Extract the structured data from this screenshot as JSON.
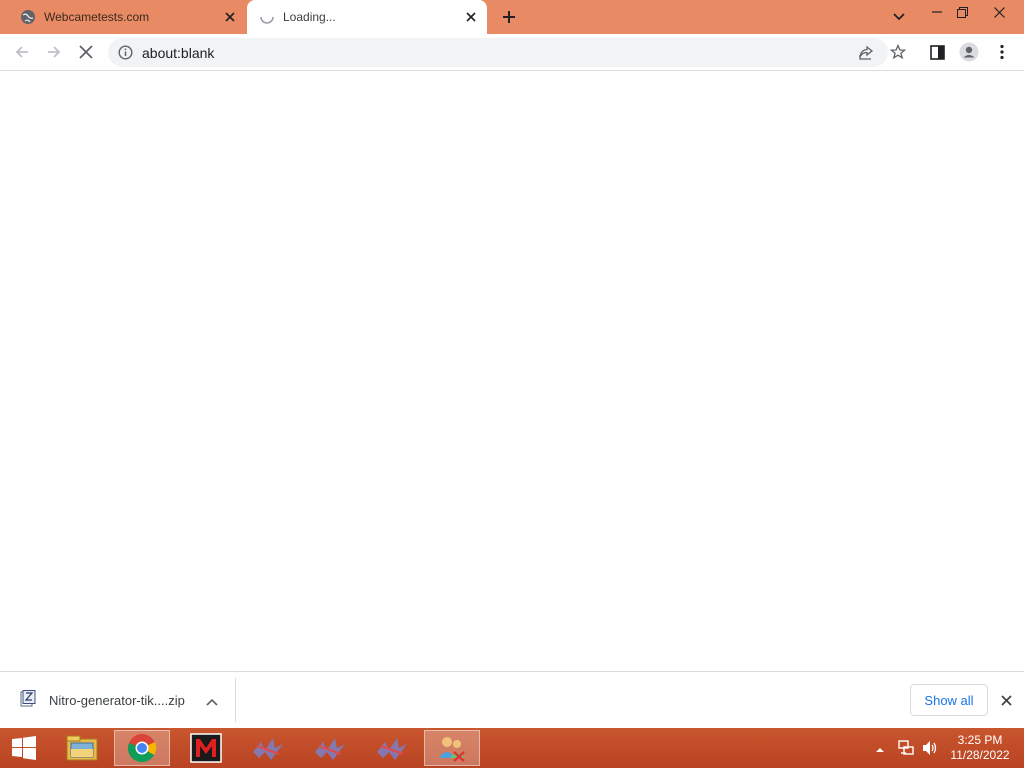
{
  "tabs": [
    {
      "title": "Webcametests.com",
      "favicon": "globe-icon"
    },
    {
      "title": "Loading...",
      "favicon": "loading-spinner-icon"
    }
  ],
  "window_controls": [
    "dropdown-icon",
    "minimize-icon",
    "restore-icon",
    "close-icon"
  ],
  "toolbar": {
    "url": "about:blank",
    "icons": [
      "back-icon",
      "forward-icon",
      "stop-icon",
      "info-icon",
      "share-icon",
      "star-icon",
      "side-panel-icon",
      "profile-icon",
      "menu-icon"
    ]
  },
  "download_bar": {
    "file_name": "Nitro-generator-tik....zip",
    "file_icon": "zip-file-icon",
    "show_all_label": "Show all"
  },
  "taskbar": {
    "apps": [
      "start-icon",
      "file-explorer-icon",
      "chrome-icon",
      "malwarebytes-icon",
      "app-icon-1",
      "app-icon-2",
      "app-icon-3",
      "network-users-icon"
    ],
    "time": "3:25 PM",
    "date": "11/28/2022"
  },
  "colors": {
    "titlebar": "#e88a63",
    "taskbar": "#c04a26",
    "accent": "#1a73e8"
  }
}
